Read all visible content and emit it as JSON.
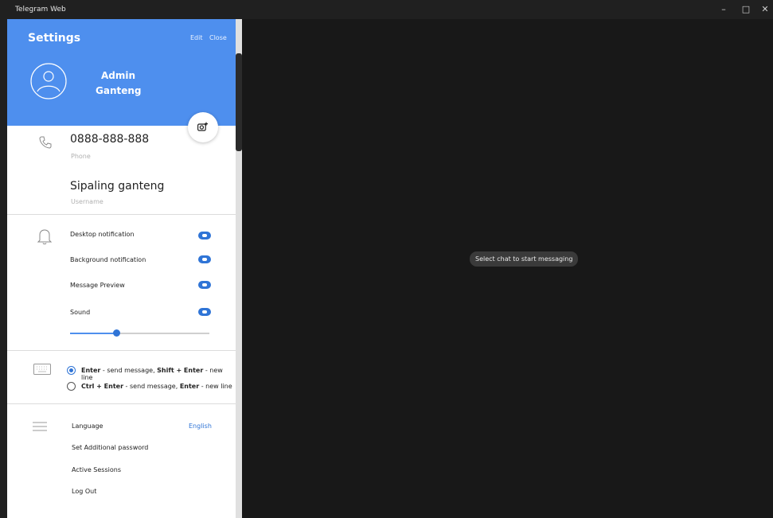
{
  "window": {
    "title": "Telegram Web"
  },
  "settings": {
    "title": "Settings",
    "edit": "Edit",
    "close": "Close",
    "name_line1": "Admin",
    "name_line2": "Ganteng",
    "phone": "0888-888-888",
    "phone_label": "Phone",
    "username": "Sipaling ganteng",
    "username_label": "Username",
    "notifications": [
      {
        "label": "Desktop notification",
        "on": true
      },
      {
        "label": "Background notification",
        "on": true
      },
      {
        "label": "Message Preview",
        "on": true
      },
      {
        "label": "Sound",
        "on": true
      }
    ],
    "volume_level_percent": 33,
    "send_options": {
      "option1": {
        "key1": "Enter",
        "text1": " - send message, ",
        "key2": "Shift + Enter",
        "text2": " - new line",
        "selected": true
      },
      "option2": {
        "key1": "Ctrl + Enter",
        "text1": " - send message, ",
        "key2": "Enter",
        "text2": " - new line",
        "selected": false
      }
    },
    "language_label": "Language",
    "language_value": "English",
    "set_password": "Set Additional password",
    "active_sessions": "Active Sessions",
    "log_out": "Log Out"
  },
  "main": {
    "empty_message": "Select chat to start messaging"
  },
  "colors": {
    "accent": "#4e8fee",
    "toggle": "#2f74d6",
    "main_bg": "#181818"
  }
}
